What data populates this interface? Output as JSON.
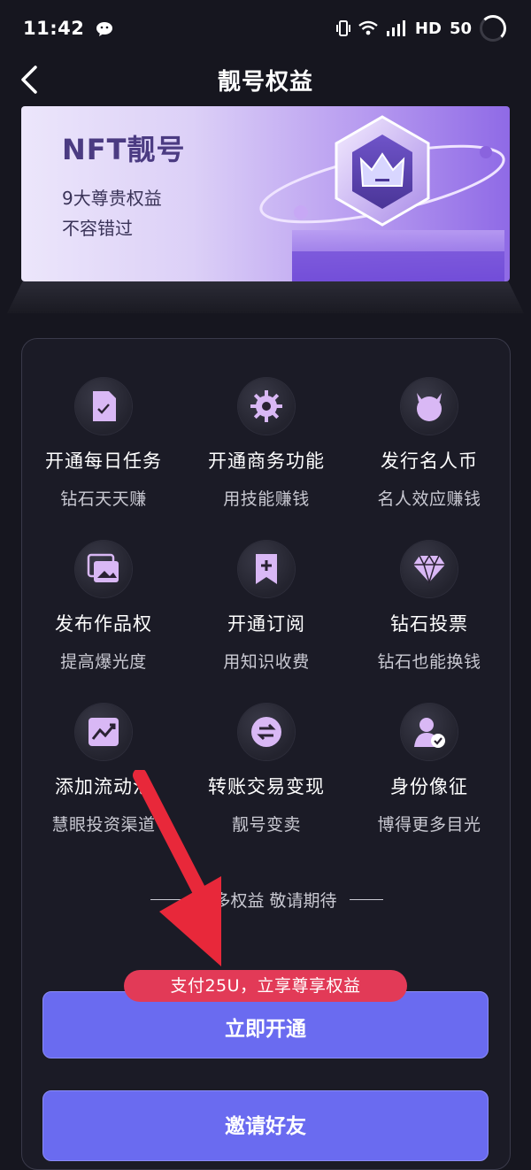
{
  "status_bar": {
    "time": "11:42",
    "network": "HD",
    "battery_text": "50",
    "icons": [
      "wechat-icon",
      "vibrate-icon",
      "wifi-icon",
      "signal-icon",
      "battery-ring-icon"
    ]
  },
  "nav": {
    "title": "靓号权益",
    "back_icon": "chevron-left-icon"
  },
  "banner": {
    "title": "NFT靓号",
    "line1": "9大尊贵权益",
    "line2": "不容错过",
    "art_icon": "crown-badge-icon"
  },
  "features": [
    {
      "title": "开通每日任务",
      "subtitle": "钻石天天赚",
      "icon": "task-document-icon"
    },
    {
      "title": "开通商务功能",
      "subtitle": "用技能赚钱",
      "icon": "gear-badge-icon"
    },
    {
      "title": "发行名人币",
      "subtitle": "名人效应赚钱",
      "icon": "celebrity-coin-icon"
    },
    {
      "title": "发布作品权",
      "subtitle": "提高爆光度",
      "icon": "gallery-icon"
    },
    {
      "title": "开通订阅",
      "subtitle": "用知识收费",
      "icon": "bookmark-plus-icon"
    },
    {
      "title": "钻石投票",
      "subtitle": "钻石也能换钱",
      "icon": "diamond-icon"
    },
    {
      "title": "添加流动池",
      "subtitle": "慧眼投资渠道",
      "icon": "trend-chart-icon"
    },
    {
      "title": "转账交易变现",
      "subtitle": "靓号变卖",
      "icon": "exchange-icon"
    },
    {
      "title": "身份像征",
      "subtitle": "博得更多目光",
      "icon": "verified-user-icon"
    }
  ],
  "more": {
    "text": "更多权益 敬请期待"
  },
  "pay_badge": "支付25U，立享尊享权益",
  "buttons": {
    "activate": "立即开通",
    "invite": "邀请好友"
  },
  "colors": {
    "background": "#16161f",
    "button": "#6a6bf0",
    "badge": "#e23a57",
    "icon_fill": "#d9b8f5",
    "arrow": "#e8283a"
  }
}
